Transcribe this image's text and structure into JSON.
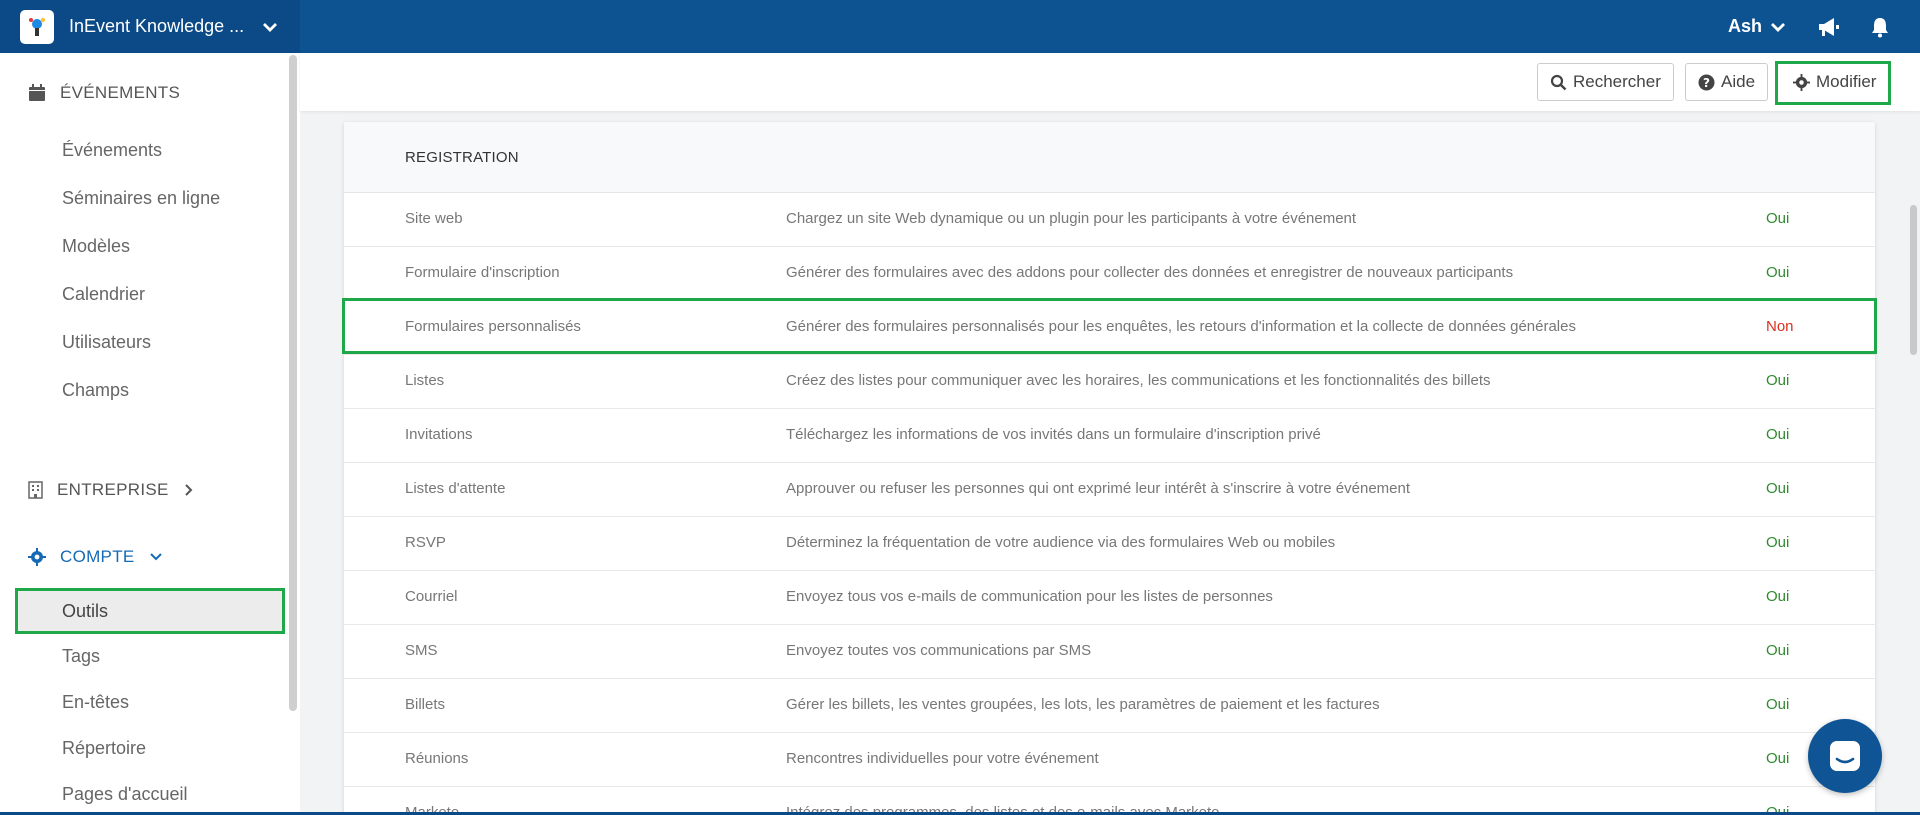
{
  "header": {
    "app_title": "InEvent Knowledge ...",
    "user_name": "Ash"
  },
  "sidebar": {
    "events_section": "ÉVÉNEMENTS",
    "events_items": [
      "Événements",
      "Séminaires en ligne",
      "Modèles",
      "Calendrier",
      "Utilisateurs",
      "Champs"
    ],
    "company_section": "ENTREPRISE",
    "account_section": "COMPTE",
    "account_items": [
      "Outils",
      "Tags",
      "En-têtes",
      "Répertoire",
      "Pages d'accueil"
    ],
    "active_item": "Outils"
  },
  "toolbar": {
    "search_label": "Rechercher",
    "help_label": "Aide",
    "edit_label": "Modifier"
  },
  "table": {
    "section_title": "REGISTRATION",
    "rows": [
      {
        "name": "Site web",
        "description": "Chargez un site Web dynamique ou un plugin pour les participants à votre événement",
        "status": "Oui"
      },
      {
        "name": "Formulaire d'inscription",
        "description": "Générer des formulaires avec des addons pour collecter des données et enregistrer de nouveaux participants",
        "status": "Oui"
      },
      {
        "name": "Formulaires personnalisés",
        "description": "Générer des formulaires personnalisés pour les enquêtes, les retours d'information et la collecte de données générales",
        "status": "Non"
      },
      {
        "name": "Listes",
        "description": "Créez des listes pour communiquer avec les horaires, les communications et les fonctionnalités des billets",
        "status": "Oui"
      },
      {
        "name": "Invitations",
        "description": "Téléchargez les informations de vos invités dans un formulaire d'inscription privé",
        "status": "Oui"
      },
      {
        "name": "Listes d'attente",
        "description": "Approuver ou refuser les personnes qui ont exprimé leur intérêt à s'inscrire à votre événement",
        "status": "Oui"
      },
      {
        "name": "RSVP",
        "description": "Déterminez la fréquentation de votre audience via des formulaires Web ou mobiles",
        "status": "Oui"
      },
      {
        "name": "Courriel",
        "description": "Envoyez tous vos e-mails de communication pour les listes de personnes",
        "status": "Oui"
      },
      {
        "name": "SMS",
        "description": "Envoyez toutes vos communications par SMS",
        "status": "Oui"
      },
      {
        "name": "Billets",
        "description": "Gérer les billets, les ventes groupées, les lots, les paramètres de paiement et les factures",
        "status": "Oui"
      },
      {
        "name": "Réunions",
        "description": "Rencontres individuelles pour votre événement",
        "status": "Oui"
      },
      {
        "name": "Marketo",
        "description": "Intégrez des programmes, des listes et des e-mails avec Marketo",
        "status": "Oui"
      }
    ]
  },
  "colors": {
    "topbar": "#0d5291",
    "highlight": "#1fa84a",
    "yes": "#2e8b2e",
    "no": "#d9301e"
  }
}
